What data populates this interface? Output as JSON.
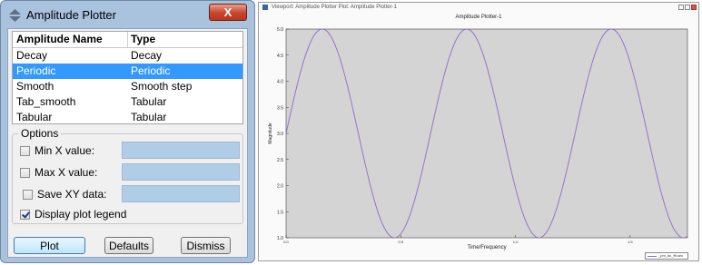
{
  "dialog": {
    "title": "Amplitude Plotter",
    "close_label": "X",
    "table": {
      "headers": [
        "Amplitude Name",
        "Type"
      ],
      "rows": [
        {
          "name": "Decay",
          "type": "Decay"
        },
        {
          "name": "Periodic",
          "type": "Periodic"
        },
        {
          "name": "Smooth",
          "type": "Smooth step"
        },
        {
          "name": "Tab_smooth",
          "type": "Tabular"
        },
        {
          "name": "Tabular",
          "type": "Tabular"
        }
      ],
      "selected_index": 1
    },
    "options": {
      "title": "Options",
      "min_x_label": "Min X value:",
      "min_x_value": "",
      "max_x_label": "Max X value:",
      "max_x_value": "",
      "save_xy_label": "Save XY data:",
      "save_xy_value": "",
      "legend_label": "Display plot legend",
      "legend_checked": true
    },
    "buttons": {
      "plot": "Plot",
      "defaults": "Defaults",
      "dismiss": "Dismiss"
    }
  },
  "viewport": {
    "title": "Viewport: Amplitude Plotter    Plot: Amplitude Plotter-1",
    "plot_title": "Amplitude Plotter-1",
    "legend_label": "_pm_ac_fft.sec"
  },
  "chart_data": {
    "type": "line",
    "title": "Amplitude Plotter-1",
    "xlabel": "Time/Frequency",
    "ylabel": "Magnitude",
    "xlim": [
      0,
      1.75
    ],
    "ylim": [
      1.0,
      5.0
    ],
    "x_ticks": [
      "0.0",
      "0.5",
      "1.0",
      "1.5"
    ],
    "y_ticks": [
      "1.0",
      "1.5",
      "2.0",
      "2.5",
      "3.0",
      "3.5",
      "4.0",
      "4.5",
      "5.0"
    ],
    "series": [
      {
        "name": "_pm_ac_fft.sec",
        "color": "#8e6bc6",
        "function": "3 + 2*sin(2*pi*x/0.63)",
        "x": [
          0,
          0.1575,
          0.315,
          0.4725,
          0.63,
          0.7875,
          0.945,
          1.1025,
          1.26,
          1.4175,
          1.575,
          1.7325,
          1.75
        ],
        "y": [
          3.0,
          5.0,
          3.0,
          1.0,
          3.0,
          5.0,
          3.0,
          1.0,
          3.0,
          5.0,
          3.0,
          1.0,
          1.03
        ]
      }
    ],
    "grid": false,
    "legend": "bottom-right",
    "background": "#d4d4d4"
  }
}
